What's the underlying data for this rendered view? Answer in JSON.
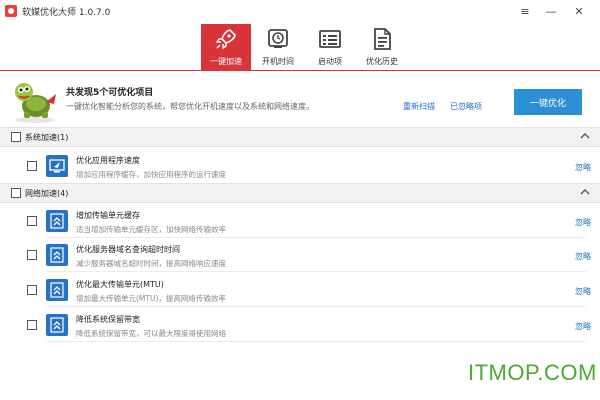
{
  "window": {
    "title": "软媒优化大师 1.0.7.0",
    "menu_glyph": "≡",
    "min_glyph": "—",
    "close_glyph": "✕"
  },
  "tabs": [
    {
      "label": "一键加速",
      "icon": "rocket-icon",
      "active": true
    },
    {
      "label": "开机时间",
      "icon": "clock-icon",
      "active": false
    },
    {
      "label": "启动项",
      "icon": "startup-list-icon",
      "active": false
    },
    {
      "label": "优化历史",
      "icon": "history-document-icon",
      "active": false
    }
  ],
  "summary": {
    "title": "共发现5个可优化项目",
    "description": "一键优化智能分析您的系统，帮您优化开机速度以及系统和网络速度。",
    "rescan_link": "重新扫描",
    "ignored_link": "已忽略项",
    "optimize_button": "一键优化"
  },
  "groups": [
    {
      "label": "系统加速(1)",
      "items": [
        {
          "title": "优化应用程序速度",
          "desc": "增加应用程序缓存，加快应用程序的运行速度",
          "ignore": "忽略",
          "icon": "monitor-rocket-icon"
        }
      ]
    },
    {
      "label": "网络加速(4)",
      "items": [
        {
          "title": "增加传输单元缓存",
          "desc": "适当增加传输单元缓存区，加快网络传输效率",
          "ignore": "忽略",
          "icon": "network-arrow-icon"
        },
        {
          "title": "优化服务器域名查询超时时间",
          "desc": "减少服务器域名超时时间，提高网络响应速度",
          "ignore": "忽略",
          "icon": "network-arrow-icon"
        },
        {
          "title": "优化最大传输单元(MTU)",
          "desc": "增加最大传输单元(MTU)，提高网络传输效率",
          "ignore": "忽略",
          "icon": "network-arrow-icon"
        },
        {
          "title": "降低系统保留带宽",
          "desc": "降低系统保留带宽，可以最大限度得使用网络",
          "ignore": "忽略",
          "icon": "network-arrow-icon"
        }
      ]
    }
  ],
  "watermark": "ITMOP.COM",
  "colors": {
    "accent_red": "#d8353a",
    "button_blue": "#2b8fd6",
    "link_blue": "#1e6fc8",
    "item_icon_blue": "#2673c6",
    "watermark_green": "#4caa32"
  }
}
